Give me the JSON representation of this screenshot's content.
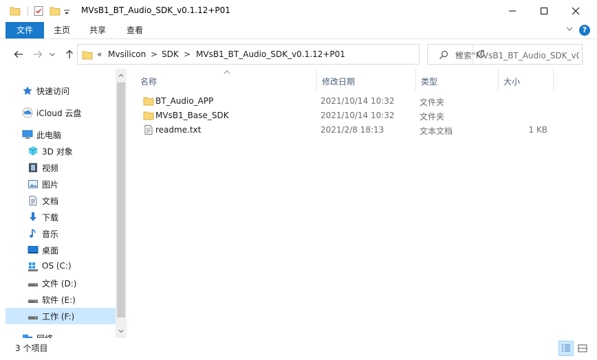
{
  "window": {
    "title": "MVsB1_BT_Audio_SDK_v0.1.12+P01"
  },
  "ribbon": {
    "tabs": [
      "文件",
      "主页",
      "共享",
      "查看"
    ],
    "help_glyph": "?"
  },
  "address": {
    "prefix": "«",
    "crumbs": [
      "Mvsilicon",
      "SDK",
      "MVsB1_BT_Audio_SDK_v0.1.12+P01"
    ],
    "separator": ">"
  },
  "search": {
    "placeholder": "搜索\"MVsB1_BT_Audio_SDK_v0..."
  },
  "sidebar": {
    "items": [
      {
        "label": "快速访问",
        "icon": "star-icon"
      },
      {
        "label": "iCloud 云盘",
        "icon": "cloud-icon"
      },
      {
        "label": "此电脑",
        "icon": "computer-icon"
      },
      {
        "label": "3D 对象",
        "icon": "3d-objects-icon"
      },
      {
        "label": "视频",
        "icon": "video-icon"
      },
      {
        "label": "图片",
        "icon": "pictures-icon"
      },
      {
        "label": "文档",
        "icon": "documents-icon"
      },
      {
        "label": "下载",
        "icon": "download-icon"
      },
      {
        "label": "音乐",
        "icon": "music-icon"
      },
      {
        "label": "桌面",
        "icon": "desktop-icon"
      },
      {
        "label": "OS (C:)",
        "icon": "windows-drive-icon"
      },
      {
        "label": "文件 (D:)",
        "icon": "drive-icon"
      },
      {
        "label": "软件 (E:)",
        "icon": "drive-icon"
      },
      {
        "label": "工作 (F:)",
        "icon": "drive-icon"
      },
      {
        "label": "网络",
        "icon": "network-icon"
      }
    ],
    "selected": "工作 (F:)"
  },
  "columns": [
    "名称",
    "修改日期",
    "类型",
    "大小"
  ],
  "files": [
    {
      "name": "BT_Audio_APP",
      "date": "2021/10/14 10:32",
      "type": "文件夹",
      "size": "",
      "icon": "folder-icon"
    },
    {
      "name": "MVsB1_Base_SDK",
      "date": "2021/10/14 10:32",
      "type": "文件夹",
      "size": "",
      "icon": "folder-icon"
    },
    {
      "name": "readme.txt",
      "date": "2021/2/8 18:13",
      "type": "文本文档",
      "size": "1 KB",
      "icon": "text-file-icon"
    }
  ],
  "status": {
    "count_text": "3 个项目"
  },
  "colors": {
    "accent": "#1979ca",
    "selection": "#cce8ff",
    "folder": "#f8d775"
  }
}
